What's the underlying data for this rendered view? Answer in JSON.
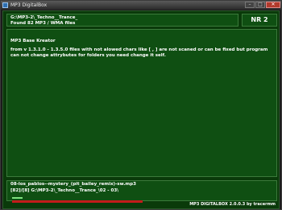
{
  "window": {
    "title": "MP3 DigitalBox",
    "controls": [
      "–",
      "□",
      "✕"
    ]
  },
  "header": {
    "path": "G:\\MP3-2\\_Techno__Trance_",
    "found": "Found 82 MP3 / WMA files",
    "nr": "NR 2"
  },
  "main": {
    "title": "MP3 Base Kreator",
    "text": "from v 1.3.1.0 - 1.3.5.0 files with not alowed chars like [ , ] are not scaned or can be fixed but program can not change attrybutes for folders you need change it self."
  },
  "status": {
    "file": "08-los_pablos--mystery_(pit_bailey_remix)-sw.mp3",
    "progress_text": "[82]/[8] G:\\MP3-2\\_Techno__Trance_\\02 - 03\\",
    "green_progress": 0.04,
    "red_progress": 0.5
  },
  "footer": {
    "version": "MP3 DIGITALBOX 2.0.0.3 by tracermm"
  },
  "colors": {
    "panel_bg": "#0f4f12",
    "client_bg": "#0a3a0a",
    "red_bar": "#c31b1b",
    "green_bar": "#7fe07f"
  }
}
